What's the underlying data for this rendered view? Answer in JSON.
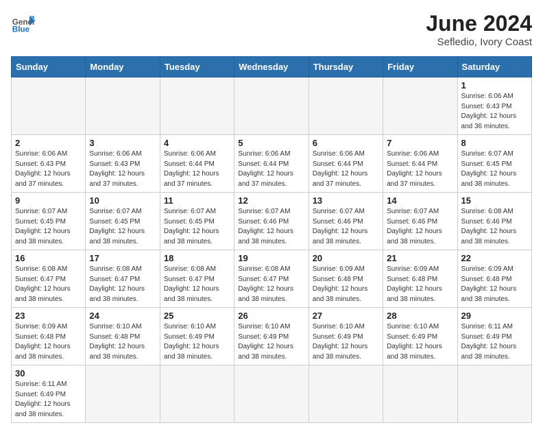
{
  "header": {
    "logo_general": "General",
    "logo_blue": "Blue",
    "month_year": "June 2024",
    "location": "Sefledio, Ivory Coast"
  },
  "weekdays": [
    "Sunday",
    "Monday",
    "Tuesday",
    "Wednesday",
    "Thursday",
    "Friday",
    "Saturday"
  ],
  "weeks": [
    [
      {
        "day": "",
        "info": ""
      },
      {
        "day": "",
        "info": ""
      },
      {
        "day": "",
        "info": ""
      },
      {
        "day": "",
        "info": ""
      },
      {
        "day": "",
        "info": ""
      },
      {
        "day": "",
        "info": ""
      },
      {
        "day": "1",
        "info": "Sunrise: 6:06 AM\nSunset: 6:43 PM\nDaylight: 12 hours and 36 minutes."
      }
    ],
    [
      {
        "day": "2",
        "info": "Sunrise: 6:06 AM\nSunset: 6:43 PM\nDaylight: 12 hours and 37 minutes."
      },
      {
        "day": "3",
        "info": "Sunrise: 6:06 AM\nSunset: 6:43 PM\nDaylight: 12 hours and 37 minutes."
      },
      {
        "day": "4",
        "info": "Sunrise: 6:06 AM\nSunset: 6:44 PM\nDaylight: 12 hours and 37 minutes."
      },
      {
        "day": "5",
        "info": "Sunrise: 6:06 AM\nSunset: 6:44 PM\nDaylight: 12 hours and 37 minutes."
      },
      {
        "day": "6",
        "info": "Sunrise: 6:06 AM\nSunset: 6:44 PM\nDaylight: 12 hours and 37 minutes."
      },
      {
        "day": "7",
        "info": "Sunrise: 6:06 AM\nSunset: 6:44 PM\nDaylight: 12 hours and 37 minutes."
      },
      {
        "day": "8",
        "info": "Sunrise: 6:07 AM\nSunset: 6:45 PM\nDaylight: 12 hours and 38 minutes."
      }
    ],
    [
      {
        "day": "9",
        "info": "Sunrise: 6:07 AM\nSunset: 6:45 PM\nDaylight: 12 hours and 38 minutes."
      },
      {
        "day": "10",
        "info": "Sunrise: 6:07 AM\nSunset: 6:45 PM\nDaylight: 12 hours and 38 minutes."
      },
      {
        "day": "11",
        "info": "Sunrise: 6:07 AM\nSunset: 6:45 PM\nDaylight: 12 hours and 38 minutes."
      },
      {
        "day": "12",
        "info": "Sunrise: 6:07 AM\nSunset: 6:46 PM\nDaylight: 12 hours and 38 minutes."
      },
      {
        "day": "13",
        "info": "Sunrise: 6:07 AM\nSunset: 6:46 PM\nDaylight: 12 hours and 38 minutes."
      },
      {
        "day": "14",
        "info": "Sunrise: 6:07 AM\nSunset: 6:46 PM\nDaylight: 12 hours and 38 minutes."
      },
      {
        "day": "15",
        "info": "Sunrise: 6:08 AM\nSunset: 6:46 PM\nDaylight: 12 hours and 38 minutes."
      }
    ],
    [
      {
        "day": "16",
        "info": "Sunrise: 6:08 AM\nSunset: 6:47 PM\nDaylight: 12 hours and 38 minutes."
      },
      {
        "day": "17",
        "info": "Sunrise: 6:08 AM\nSunset: 6:47 PM\nDaylight: 12 hours and 38 minutes."
      },
      {
        "day": "18",
        "info": "Sunrise: 6:08 AM\nSunset: 6:47 PM\nDaylight: 12 hours and 38 minutes."
      },
      {
        "day": "19",
        "info": "Sunrise: 6:08 AM\nSunset: 6:47 PM\nDaylight: 12 hours and 38 minutes."
      },
      {
        "day": "20",
        "info": "Sunrise: 6:09 AM\nSunset: 6:48 PM\nDaylight: 12 hours and 38 minutes."
      },
      {
        "day": "21",
        "info": "Sunrise: 6:09 AM\nSunset: 6:48 PM\nDaylight: 12 hours and 38 minutes."
      },
      {
        "day": "22",
        "info": "Sunrise: 6:09 AM\nSunset: 6:48 PM\nDaylight: 12 hours and 38 minutes."
      }
    ],
    [
      {
        "day": "23",
        "info": "Sunrise: 6:09 AM\nSunset: 6:48 PM\nDaylight: 12 hours and 38 minutes."
      },
      {
        "day": "24",
        "info": "Sunrise: 6:10 AM\nSunset: 6:48 PM\nDaylight: 12 hours and 38 minutes."
      },
      {
        "day": "25",
        "info": "Sunrise: 6:10 AM\nSunset: 6:49 PM\nDaylight: 12 hours and 38 minutes."
      },
      {
        "day": "26",
        "info": "Sunrise: 6:10 AM\nSunset: 6:49 PM\nDaylight: 12 hours and 38 minutes."
      },
      {
        "day": "27",
        "info": "Sunrise: 6:10 AM\nSunset: 6:49 PM\nDaylight: 12 hours and 38 minutes."
      },
      {
        "day": "28",
        "info": "Sunrise: 6:10 AM\nSunset: 6:49 PM\nDaylight: 12 hours and 38 minutes."
      },
      {
        "day": "29",
        "info": "Sunrise: 6:11 AM\nSunset: 6:49 PM\nDaylight: 12 hours and 38 minutes."
      }
    ],
    [
      {
        "day": "30",
        "info": "Sunrise: 6:11 AM\nSunset: 6:49 PM\nDaylight: 12 hours and 38 minutes."
      },
      {
        "day": "",
        "info": ""
      },
      {
        "day": "",
        "info": ""
      },
      {
        "day": "",
        "info": ""
      },
      {
        "day": "",
        "info": ""
      },
      {
        "day": "",
        "info": ""
      },
      {
        "day": "",
        "info": ""
      }
    ]
  ]
}
